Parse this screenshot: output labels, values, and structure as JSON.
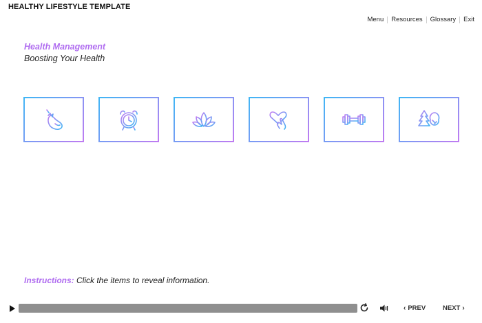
{
  "app": {
    "title": "HEALTHY LIFESTYLE TEMPLATE"
  },
  "nav": {
    "menu": "Menu",
    "resources": "Resources",
    "glossary": "Glossary",
    "exit": "Exit"
  },
  "content": {
    "heading": "Health Management",
    "subheading": "Boosting Your Health",
    "tiles": [
      {
        "icon": "eggplant-icon"
      },
      {
        "icon": "alarm-clock-icon"
      },
      {
        "icon": "lotus-icon"
      },
      {
        "icon": "heart-hand-icon"
      },
      {
        "icon": "dumbbell-icon"
      },
      {
        "icon": "trees-icon"
      }
    ]
  },
  "instructions": {
    "label": "Instructions:",
    "text": " Click the items to reveal information."
  },
  "player": {
    "progress": 1.0,
    "prev": "PREV",
    "next": "NEXT"
  },
  "colors": {
    "accent": "#b06df0",
    "gradient_start": "#3fb6f5",
    "gradient_end": "#c07bf2"
  }
}
